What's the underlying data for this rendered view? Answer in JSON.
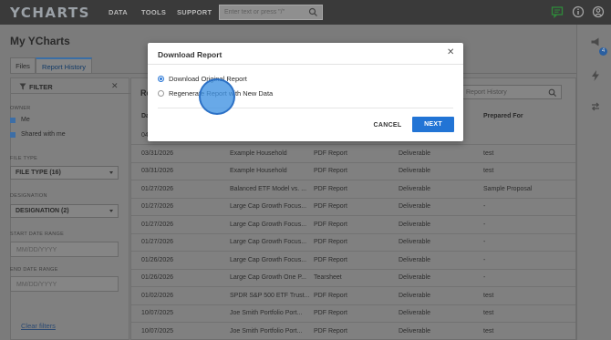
{
  "nav": {
    "logo": "YCHARTS",
    "items": [
      "DATA",
      "TOOLS",
      "SUPPORT"
    ],
    "search_placeholder": "Enter text or press \"/\""
  },
  "page": {
    "title": "My YCharts",
    "tabs": [
      "Files",
      "Report History"
    ],
    "active_tab": "Report History"
  },
  "rail": {
    "badge": "4"
  },
  "filter": {
    "title": "FILTER",
    "owner_label": "OWNER",
    "owner_options": [
      "Me",
      "Shared with me"
    ],
    "file_type_label": "FILE TYPE",
    "file_type_value": "FILE TYPE (16)",
    "designation_label": "DESIGNATION",
    "designation_value": "DESIGNATION (2)",
    "start_date_label": "START DATE RANGE",
    "start_date_placeholder": "MM/DD/YYYY",
    "end_date_label": "END DATE RANGE",
    "end_date_placeholder": "MM/DD/YYYY",
    "clear": "Clear filters"
  },
  "table": {
    "title_partial": "Re",
    "search_placeholder": "Report History",
    "headers": [
      "Da",
      "Prepared For"
    ],
    "rows": [
      [
        "04",
        "",
        "",
        "",
        ""
      ],
      [
        "03/31/2026",
        "Example Household",
        "PDF Report",
        "Deliverable",
        "test"
      ],
      [
        "03/31/2026",
        "Example Household",
        "PDF Report",
        "Deliverable",
        "test"
      ],
      [
        "01/27/2026",
        "Balanced ETF Model vs. ...",
        "PDF Report",
        "Deliverable",
        "Sample Proposal"
      ],
      [
        "01/27/2026",
        "Large Cap Growth Focus...",
        "PDF Report",
        "Deliverable",
        "-"
      ],
      [
        "01/27/2026",
        "Large Cap Growth Focus...",
        "PDF Report",
        "Deliverable",
        "-"
      ],
      [
        "01/27/2026",
        "Large Cap Growth Focus...",
        "PDF Report",
        "Deliverable",
        "-"
      ],
      [
        "01/26/2026",
        "Large Cap Growth Focus...",
        "PDF Report",
        "Deliverable",
        "-"
      ],
      [
        "01/26/2026",
        "Large Cap Growth One P...",
        "Tearsheet",
        "Deliverable",
        "-"
      ],
      [
        "01/02/2026",
        "SPDR S&P 500 ETF Trust...",
        "PDF Report",
        "Deliverable",
        "test"
      ],
      [
        "10/07/2025",
        "Joe Smith Portfolio Port...",
        "PDF Report",
        "Deliverable",
        "test"
      ],
      [
        "10/07/2025",
        "Joe Smith Portfolio Port...",
        "PDF Report",
        "Deliverable",
        "test"
      ]
    ]
  },
  "dialog": {
    "title": "Download Report",
    "options": [
      "Download Original Report",
      "Regenerate Report with New Data"
    ],
    "selected": "Download Original Report",
    "cancel": "CANCEL",
    "next": "NEXT"
  }
}
